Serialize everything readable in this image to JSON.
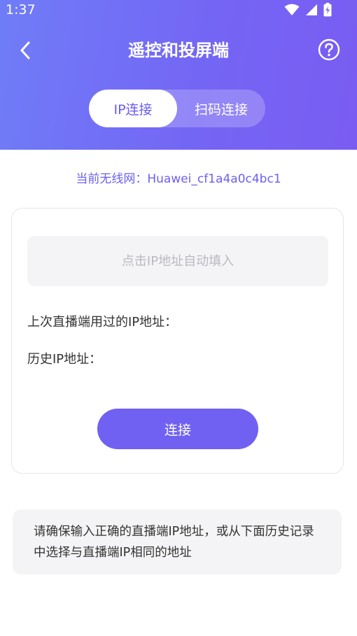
{
  "status_bar": {
    "time": "1:37",
    "icons": [
      "wifi-icon",
      "signal-icon",
      "battery-charging-icon"
    ]
  },
  "nav": {
    "back_icon": "chevron-left-icon",
    "title": "遥控和投屏端",
    "help_icon": "help-circle-icon"
  },
  "tabs": [
    {
      "label": "IP连接",
      "active": true
    },
    {
      "label": "扫码连接",
      "active": false
    }
  ],
  "wifi": {
    "label": "当前无线网：",
    "ssid": "Huawei_cf1a4a0c4bc1"
  },
  "form": {
    "ip_placeholder": "点击IP地址自动填入",
    "ip_value": "",
    "last_ip_label": "上次直播端用过的IP地址：",
    "history_label": "历史IP地址：",
    "connect_label": "连接"
  },
  "note": "请确保输入正确的直播端IP地址，或从下面历史记录中选择与直播端IP相同的地址",
  "colors": {
    "accent": "#7161f2",
    "header_gradient_start": "#6f7df7",
    "header_gradient_end": "#7a5cf2",
    "text": "#333333",
    "placeholder": "#b9b9c1"
  }
}
